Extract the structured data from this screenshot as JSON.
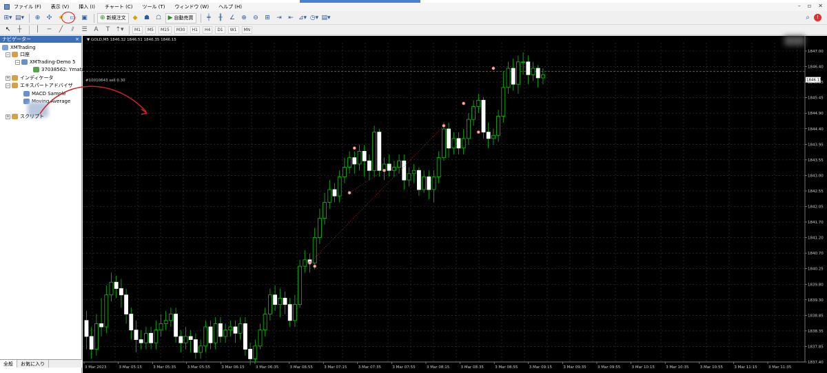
{
  "menu": {
    "items": [
      "ファイル (F)",
      "表示 (V)",
      "挿入 (I)",
      "チャート (C)",
      "ツール (T)",
      "ウィンドウ (W)",
      "ヘルプ (H)"
    ]
  },
  "toolbar1": {
    "new_order": "新規注文",
    "auto_trading": "自動売買"
  },
  "toolbar2": {
    "timeframes": [
      "M1",
      "M5",
      "M15",
      "M30",
      "H1",
      "H4",
      "D1",
      "W1",
      "MN"
    ]
  },
  "navigator": {
    "title": "ナビゲーター",
    "close": "×",
    "root": "XMTrading",
    "accounts": "口座",
    "server": "XMTrading-Demo 5",
    "account_id": "37038562: Ymata",
    "indicators": "インディケータ",
    "experts": "エキスパートアドバイザ",
    "expert_items": [
      "MACD Sample",
      "Moving Average"
    ],
    "scripts": "スクリプト",
    "tabs": [
      "全般",
      "お気に入り"
    ]
  },
  "chart": {
    "symbol_line": "▼ GOLD,M5  1846.32 1846.51 1846.35 1846.15",
    "trade_line": "#10010643 sell 0.30",
    "price_box": "1846.15",
    "price_labels": [
      "1847.00",
      "1846.40",
      "1845.95",
      "1845.45",
      "1844.90",
      "1844.40",
      "1843.95",
      "1843.55",
      "1843.00",
      "1842.55",
      "1842.05",
      "1841.70",
      "1841.20",
      "1840.70",
      "1840.25",
      "1839.80",
      "1839.30",
      "1838.85",
      "1838.35",
      "1837.85",
      "1837.40"
    ],
    "time_labels": [
      "3 Mar 2023",
      "3 Mar 05:15",
      "3 Mar 05:35",
      "3 Mar 05:55",
      "3 Mar 06:15",
      "3 Mar 06:35",
      "3 Mar 06:55",
      "3 Mar 07:15",
      "3 Mar 07:35",
      "3 Mar 07:55",
      "3 Mar 08:15",
      "3 Mar 08:35",
      "3 Mar 08:55",
      "3 Mar 09:15",
      "3 Mar 09:35",
      "3 Mar 09:55",
      "3 Mar 10:15",
      "3 Mar 10:35",
      "3 Mar 10:55",
      "3 Mar 11:15",
      "3 Mar 11:35"
    ]
  },
  "chart_data": {
    "type": "candlestick",
    "symbol": "GOLD",
    "timeframe": "M5",
    "ylim": [
      1837.2,
      1847.2
    ],
    "candles": [
      [
        1838.5,
        1838.0,
        1838.8,
        1837.6
      ],
      [
        1838.0,
        1837.6,
        1838.3,
        1837.3
      ],
      [
        1837.6,
        1838.4,
        1838.7,
        1837.4
      ],
      [
        1838.4,
        1838.3,
        1839.2,
        1838.0
      ],
      [
        1838.3,
        1839.3,
        1839.6,
        1838.1
      ],
      [
        1839.3,
        1839.7,
        1840.0,
        1839.1
      ],
      [
        1839.7,
        1839.5,
        1839.9,
        1839.2
      ],
      [
        1839.5,
        1839.3,
        1839.8,
        1838.9
      ],
      [
        1839.3,
        1838.7,
        1839.5,
        1838.4
      ],
      [
        1838.7,
        1838.2,
        1838.9,
        1837.9
      ],
      [
        1838.2,
        1837.9,
        1838.5,
        1837.5
      ],
      [
        1837.9,
        1837.8,
        1838.2,
        1837.6
      ],
      [
        1837.8,
        1838.1,
        1838.3,
        1837.6
      ],
      [
        1838.1,
        1837.8,
        1838.3,
        1837.6
      ],
      [
        1837.8,
        1838.2,
        1838.5,
        1837.6
      ],
      [
        1838.2,
        1838.4,
        1838.7,
        1838.0
      ],
      [
        1838.4,
        1838.5,
        1838.8,
        1838.2
      ],
      [
        1838.5,
        1838.7,
        1838.9,
        1838.3
      ],
      [
        1838.7,
        1838.0,
        1838.9,
        1837.8
      ],
      [
        1838.0,
        1837.8,
        1838.2,
        1837.5
      ],
      [
        1837.8,
        1838.0,
        1838.3,
        1837.6
      ],
      [
        1838.0,
        1837.9,
        1838.2,
        1837.5
      ],
      [
        1837.9,
        1837.5,
        1838.1,
        1837.3
      ],
      [
        1837.5,
        1837.7,
        1837.9,
        1837.3
      ],
      [
        1837.7,
        1838.3,
        1838.5,
        1837.5
      ],
      [
        1838.3,
        1837.8,
        1838.5,
        1837.6
      ],
      [
        1837.8,
        1838.4,
        1838.6,
        1837.6
      ],
      [
        1838.4,
        1838.0,
        1838.6,
        1837.8
      ],
      [
        1838.0,
        1838.2,
        1838.4,
        1837.8
      ],
      [
        1838.2,
        1838.3,
        1838.5,
        1838.0
      ],
      [
        1838.3,
        1838.1,
        1838.5,
        1837.8
      ],
      [
        1838.1,
        1838.4,
        1838.6,
        1837.9
      ],
      [
        1838.4,
        1837.6,
        1838.6,
        1837.4
      ],
      [
        1837.6,
        1837.3,
        1837.8,
        1837.1
      ],
      [
        1837.3,
        1837.7,
        1837.9,
        1837.2
      ],
      [
        1837.7,
        1838.2,
        1838.4,
        1837.6
      ],
      [
        1838.2,
        1838.7,
        1838.9,
        1838.0
      ],
      [
        1838.7,
        1839.3,
        1839.5,
        1838.5
      ],
      [
        1839.3,
        1839.0,
        1839.6,
        1838.8
      ],
      [
        1839.0,
        1839.2,
        1839.5,
        1838.6
      ],
      [
        1839.2,
        1839.0,
        1839.4,
        1838.7
      ],
      [
        1839.0,
        1838.5,
        1839.2,
        1838.3
      ],
      [
        1838.5,
        1839.0,
        1839.3,
        1838.3
      ],
      [
        1839.0,
        1840.2,
        1840.4,
        1838.9
      ],
      [
        1840.2,
        1840.4,
        1840.7,
        1840.0
      ],
      [
        1840.4,
        1840.3,
        1840.6,
        1840.0
      ],
      [
        1840.3,
        1841.1,
        1841.4,
        1840.1
      ],
      [
        1841.1,
        1841.7,
        1842.0,
        1840.9
      ],
      [
        1841.7,
        1842.2,
        1842.5,
        1841.5
      ],
      [
        1842.2,
        1842.6,
        1842.9,
        1842.0
      ],
      [
        1842.6,
        1842.4,
        1842.8,
        1842.2
      ],
      [
        1842.4,
        1843.0,
        1843.2,
        1842.2
      ],
      [
        1843.0,
        1843.3,
        1843.6,
        1842.8
      ],
      [
        1843.3,
        1843.6,
        1843.8,
        1843.1
      ],
      [
        1843.6,
        1843.4,
        1843.8,
        1843.1
      ],
      [
        1843.4,
        1843.8,
        1844.0,
        1843.2
      ],
      [
        1843.8,
        1843.5,
        1844.0,
        1843.0
      ],
      [
        1843.5,
        1843.2,
        1843.7,
        1842.9
      ],
      [
        1843.2,
        1844.4,
        1844.6,
        1843.0
      ],
      [
        1844.4,
        1843.2,
        1844.5,
        1843.0
      ],
      [
        1843.2,
        1843.4,
        1843.6,
        1842.9
      ],
      [
        1843.4,
        1843.2,
        1843.7,
        1843.0
      ],
      [
        1843.2,
        1843.3,
        1843.5,
        1843.0
      ],
      [
        1843.3,
        1843.5,
        1843.7,
        1843.1
      ],
      [
        1843.5,
        1842.9,
        1843.7,
        1842.6
      ],
      [
        1842.9,
        1843.1,
        1843.3,
        1842.7
      ],
      [
        1843.1,
        1843.2,
        1843.4,
        1842.8
      ],
      [
        1843.2,
        1842.6,
        1843.3,
        1842.4
      ],
      [
        1842.6,
        1843.0,
        1843.2,
        1842.5
      ],
      [
        1843.0,
        1842.6,
        1843.2,
        1842.3
      ],
      [
        1842.6,
        1843.0,
        1843.2,
        1842.2
      ],
      [
        1843.0,
        1843.6,
        1843.8,
        1842.8
      ],
      [
        1843.6,
        1844.5,
        1844.7,
        1843.5
      ],
      [
        1844.5,
        1843.9,
        1844.7,
        1843.6
      ],
      [
        1843.9,
        1844.2,
        1844.4,
        1843.7
      ],
      [
        1844.2,
        1843.9,
        1844.4,
        1843.7
      ],
      [
        1843.9,
        1844.2,
        1844.5,
        1843.7
      ],
      [
        1844.2,
        1844.8,
        1845.0,
        1844.0
      ],
      [
        1844.8,
        1845.2,
        1845.4,
        1844.6
      ],
      [
        1845.2,
        1845.4,
        1845.6,
        1845.0
      ],
      [
        1845.4,
        1844.4,
        1845.5,
        1844.2
      ],
      [
        1844.4,
        1844.2,
        1844.7,
        1843.9
      ],
      [
        1844.2,
        1844.3,
        1844.5,
        1844.0
      ],
      [
        1844.3,
        1844.9,
        1845.1,
        1844.1
      ],
      [
        1844.9,
        1845.8,
        1846.3,
        1844.7
      ],
      [
        1845.8,
        1846.4,
        1846.6,
        1845.6
      ],
      [
        1846.4,
        1845.9,
        1846.7,
        1845.7
      ],
      [
        1845.9,
        1846.6,
        1846.8,
        1845.6
      ],
      [
        1846.6,
        1846.6,
        1846.9,
        1846.2
      ],
      [
        1846.6,
        1846.2,
        1846.8,
        1845.9
      ],
      [
        1846.2,
        1846.4,
        1846.6,
        1846.0
      ],
      [
        1846.4,
        1846.1,
        1846.5,
        1845.8
      ],
      [
        1846.1,
        1846.2,
        1846.4,
        1845.9
      ]
    ],
    "horizontal_line": 1846.3,
    "markers": [
      [
        54,
        1843.9
      ],
      [
        46,
        1840.2
      ],
      [
        45,
        1840.3
      ],
      [
        60,
        1843.2
      ],
      [
        53,
        1842.5
      ],
      [
        72,
        1844.6
      ],
      [
        76,
        1845.3
      ],
      [
        82,
        1846.4
      ],
      [
        79,
        1844.4
      ]
    ]
  },
  "colors": {
    "bull": "#00cc00",
    "bear_fill": "#ffffff",
    "grid": "#3a3a3a",
    "annotation": "#d02020",
    "nav_header": "#3d6fb8"
  }
}
